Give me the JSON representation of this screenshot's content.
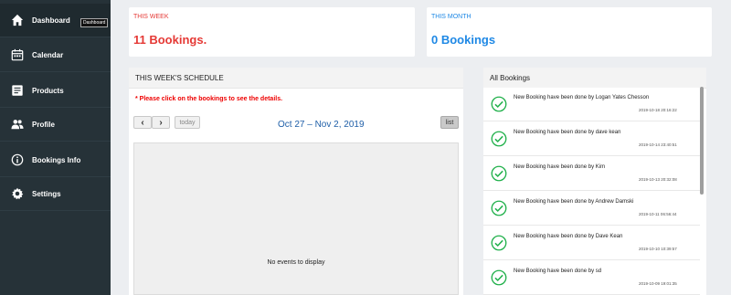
{
  "sidebar": {
    "items": [
      {
        "label": "Dashboard",
        "icon": "home-icon"
      },
      {
        "label": "Calendar",
        "icon": "calendar-icon"
      },
      {
        "label": "Products",
        "icon": "products-icon"
      },
      {
        "label": "Profile",
        "icon": "users-icon"
      },
      {
        "label": "Bookings Info",
        "icon": "info-icon"
      },
      {
        "label": "Settings",
        "icon": "gear-icon"
      }
    ],
    "tooltip": "Dashboard"
  },
  "stats": {
    "week": {
      "label": "THIS WEEK",
      "value": "11 Bookings.",
      "color": "#e53935"
    },
    "month": {
      "label": "THIS MONTH",
      "value": "0 Bookings",
      "color": "#1e88e5"
    }
  },
  "schedule": {
    "title": "THIS WEEK'S SCHEDULE",
    "note": "* Please click on the bookings to see the details.",
    "prev": "‹",
    "next": "›",
    "today": "today",
    "range": "Oct 27 – Nov 2, 2019",
    "view": "list",
    "empty": "No events to display"
  },
  "bookings": {
    "title": "All Bookings",
    "accent": "#22b14c",
    "items": [
      {
        "text": "New Booking have been done by Logan Yates Chesson",
        "time": "2019-10-18 20:16:22"
      },
      {
        "text": "New Booking have been done by dave kean",
        "time": "2019-10-14 23:40:51"
      },
      {
        "text": "New Booking have been done by Kim",
        "time": "2019-10-13 20:32:08"
      },
      {
        "text": "New Booking have been done by Andrew Damski",
        "time": "2019-10-11 06:56:44"
      },
      {
        "text": "New Booking have been done by Dave Kean",
        "time": "2019-10-10 10:39:57"
      },
      {
        "text": "New Booking have been done by sd",
        "time": "2019-10-09 19:01:35"
      }
    ]
  }
}
